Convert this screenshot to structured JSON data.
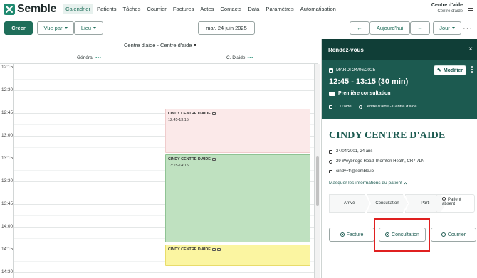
{
  "brand": {
    "name": "Semble",
    "color": "#1f8a70"
  },
  "nav": {
    "items": [
      {
        "label": "Calendrier",
        "active": true
      },
      {
        "label": "Patients"
      },
      {
        "label": "Tâches"
      },
      {
        "label": "Courrier"
      },
      {
        "label": "Factures"
      },
      {
        "label": "Actes"
      },
      {
        "label": "Contacts"
      },
      {
        "label": "Data"
      },
      {
        "label": "Paramètres"
      },
      {
        "label": "Automatisation"
      }
    ]
  },
  "user": {
    "name": "Centre d'aide",
    "location": "Centre d'aide"
  },
  "toolbar": {
    "create_label": "Créer",
    "view_by_label": "Vue par",
    "place_label": "Lieu",
    "date_label": "mar. 24 juin 2025",
    "prev_icon": "←",
    "today_label": "Aujourd'hui",
    "next_icon": "→",
    "view_mode_label": "Jour",
    "more_icon": "···"
  },
  "calendar": {
    "location_header": "Centre d'aide - Centre d'aide",
    "resources": [
      {
        "label": "Général",
        "dots": "•••"
      },
      {
        "label": "C. D'aide",
        "dots": "•••"
      }
    ],
    "time_labels": [
      "12:15",
      "12:30",
      "12:45",
      "13:00",
      "13:15",
      "13:30",
      "13:45",
      "14:00",
      "14:15",
      "14:30"
    ],
    "events": [
      {
        "name": "CINDY CENTRE D'AIDE",
        "time": "12:45-13:15",
        "color": "#fbe9e9"
      },
      {
        "name": "CINDY CENTRE D'AIDE",
        "time": "13:15-14:15",
        "color": "#bfe1c0"
      },
      {
        "name": "CINDY CENTRE D'AIDE",
        "time": "",
        "color": "#fbf5a1"
      }
    ]
  },
  "panel": {
    "title": "Rendez-vous",
    "close_icon": "×",
    "date": "MARDI 24/06/2025",
    "modify_label": "Modifier",
    "time_range": "12:45 - 13:15  (30 min)",
    "type": "Première consultation",
    "practitioner": "C. D'aide",
    "location": "Centre d'aide - Centre d'aide",
    "patient": {
      "name": "CINDY CENTRE D'AIDE",
      "dob": "24/04/2001, 24 ans",
      "address": "29 Weybridge Road Thornton Heath, CR7 7LN",
      "email": "cindy+fr@semble.io"
    },
    "mask_label": "Masquer les informations du patient",
    "statuses": [
      "Arrivé",
      "Consultation",
      "Parti"
    ],
    "absent_label_1": "Patient",
    "absent_label_2": "absent",
    "actions": {
      "invoice": "Facture",
      "consultation": "Consultation",
      "mail": "Courrier"
    },
    "accent": "#1c5a50",
    "header_color": "#103e37"
  },
  "highlight_color": "#e02020"
}
